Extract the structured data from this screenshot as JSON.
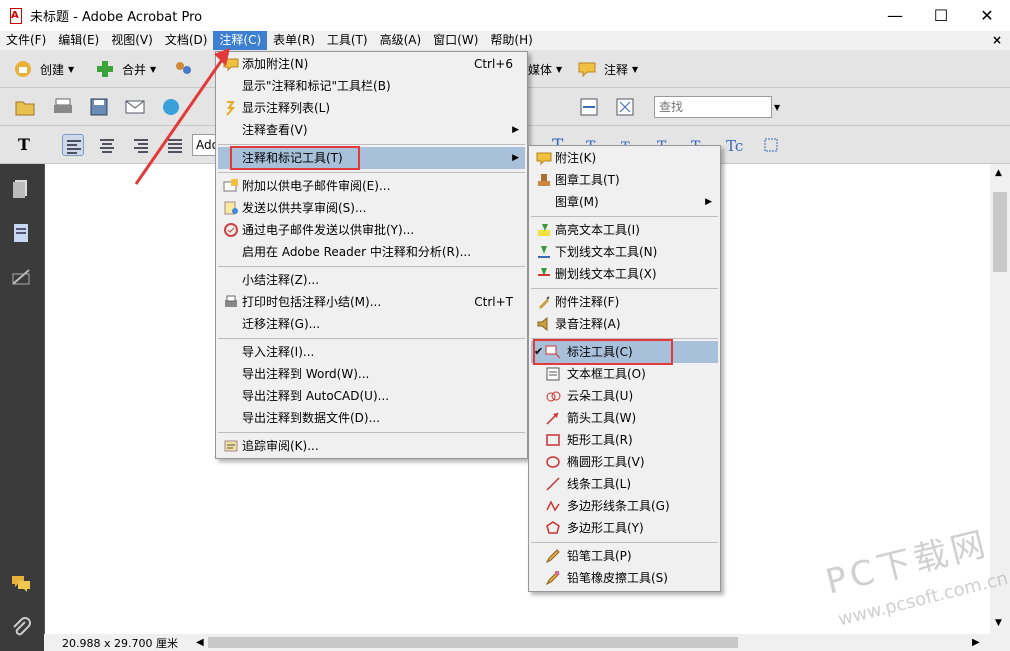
{
  "window": {
    "title": "未标题 - Adobe Acrobat Pro",
    "minimize": "—",
    "maximize": "☐",
    "close": "✕"
  },
  "menubar": {
    "items": [
      "文件(F)",
      "编辑(E)",
      "视图(V)",
      "文档(D)",
      "注释(C)",
      "表单(R)",
      "工具(T)",
      "高级(A)",
      "窗口(W)",
      "帮助(H)"
    ],
    "active_index": 4,
    "close_doc": "×"
  },
  "toolbar1": {
    "create": "创建",
    "combine": "合并",
    "multimedia": "媒体",
    "comment": "注释"
  },
  "toolbar2": {
    "search_placeholder": "查找"
  },
  "toolbar3": {
    "font_box": "Adob"
  },
  "comment_menu": {
    "items": [
      {
        "label": "添加附注(N)",
        "shortcut": "Ctrl+6",
        "icon": "note-icon"
      },
      {
        "label": "显示\"注释和标记\"工具栏(B)",
        "icon": ""
      },
      {
        "label": "显示注释列表(L)",
        "icon": "list-icon"
      },
      {
        "label": "注释查看(V)",
        "icon": "",
        "submenu": true
      },
      {
        "label": "注释和标记工具(T)",
        "icon": "",
        "submenu": true,
        "highlighted": true
      },
      {
        "label": "附加以供电子邮件审阅(E)...",
        "icon": "email-attach-icon"
      },
      {
        "label": "发送以供共享审阅(S)...",
        "icon": "share-review-icon"
      },
      {
        "label": "通过电子邮件发送以供审批(Y)...",
        "icon": "approval-icon"
      },
      {
        "label": "启用在 Adobe Reader 中注释和分析(R)...",
        "icon": ""
      },
      {
        "label": "小结注释(Z)...",
        "icon": ""
      },
      {
        "label": "打印时包括注释小结(M)...",
        "shortcut": "Ctrl+T",
        "icon": "print-summary-icon"
      },
      {
        "label": "迁移注释(G)...",
        "icon": ""
      },
      {
        "label": "导入注释(I)...",
        "icon": ""
      },
      {
        "label": "导出注释到 Word(W)...",
        "icon": ""
      },
      {
        "label": "导出注释到 AutoCAD(U)...",
        "icon": ""
      },
      {
        "label": "导出注释到数据文件(D)...",
        "icon": ""
      },
      {
        "label": "追踪审阅(K)...",
        "icon": "track-review-icon"
      }
    ]
  },
  "markup_menu": {
    "items": [
      {
        "label": "附注(K)",
        "icon": "note-icon"
      },
      {
        "label": "图章工具(T)",
        "icon": "stamp-icon"
      },
      {
        "label": "图章(M)",
        "icon": "",
        "submenu": true
      },
      {
        "label": "高亮文本工具(I)",
        "icon": "highlight-icon"
      },
      {
        "label": "下划线文本工具(N)",
        "icon": "underline-icon"
      },
      {
        "label": "删划线文本工具(X)",
        "icon": "strikethrough-icon"
      },
      {
        "label": "附件注释(F)",
        "icon": "attachment-icon"
      },
      {
        "label": "录音注释(A)",
        "icon": "sound-icon"
      },
      {
        "label": "标注工具(C)",
        "icon": "callout-icon",
        "checked": true,
        "highlighted": true
      },
      {
        "label": "文本框工具(O)",
        "icon": "textbox-icon"
      },
      {
        "label": "云朵工具(U)",
        "icon": "cloud-icon"
      },
      {
        "label": "箭头工具(W)",
        "icon": "arrow-icon"
      },
      {
        "label": "矩形工具(R)",
        "icon": "rectangle-icon"
      },
      {
        "label": "椭圆形工具(V)",
        "icon": "ellipse-icon"
      },
      {
        "label": "线条工具(L)",
        "icon": "line-icon"
      },
      {
        "label": "多边形线条工具(G)",
        "icon": "polyline-icon"
      },
      {
        "label": "多边形工具(Y)",
        "icon": "polygon-icon"
      },
      {
        "label": "铅笔工具(P)",
        "icon": "pencil-icon"
      },
      {
        "label": "铅笔橡皮擦工具(S)",
        "icon": "pencil-eraser-icon"
      }
    ],
    "check_mark": "✔"
  },
  "status": {
    "page_size": "20.988 x 29.700 厘米"
  },
  "watermark": {
    "logo": "PC下载网",
    "url": "www.pcsoft.com.cn"
  },
  "colors": {
    "accent": "#3d7fd0",
    "highlight": "#a8c0da",
    "annotation_red": "#e03a3a"
  }
}
